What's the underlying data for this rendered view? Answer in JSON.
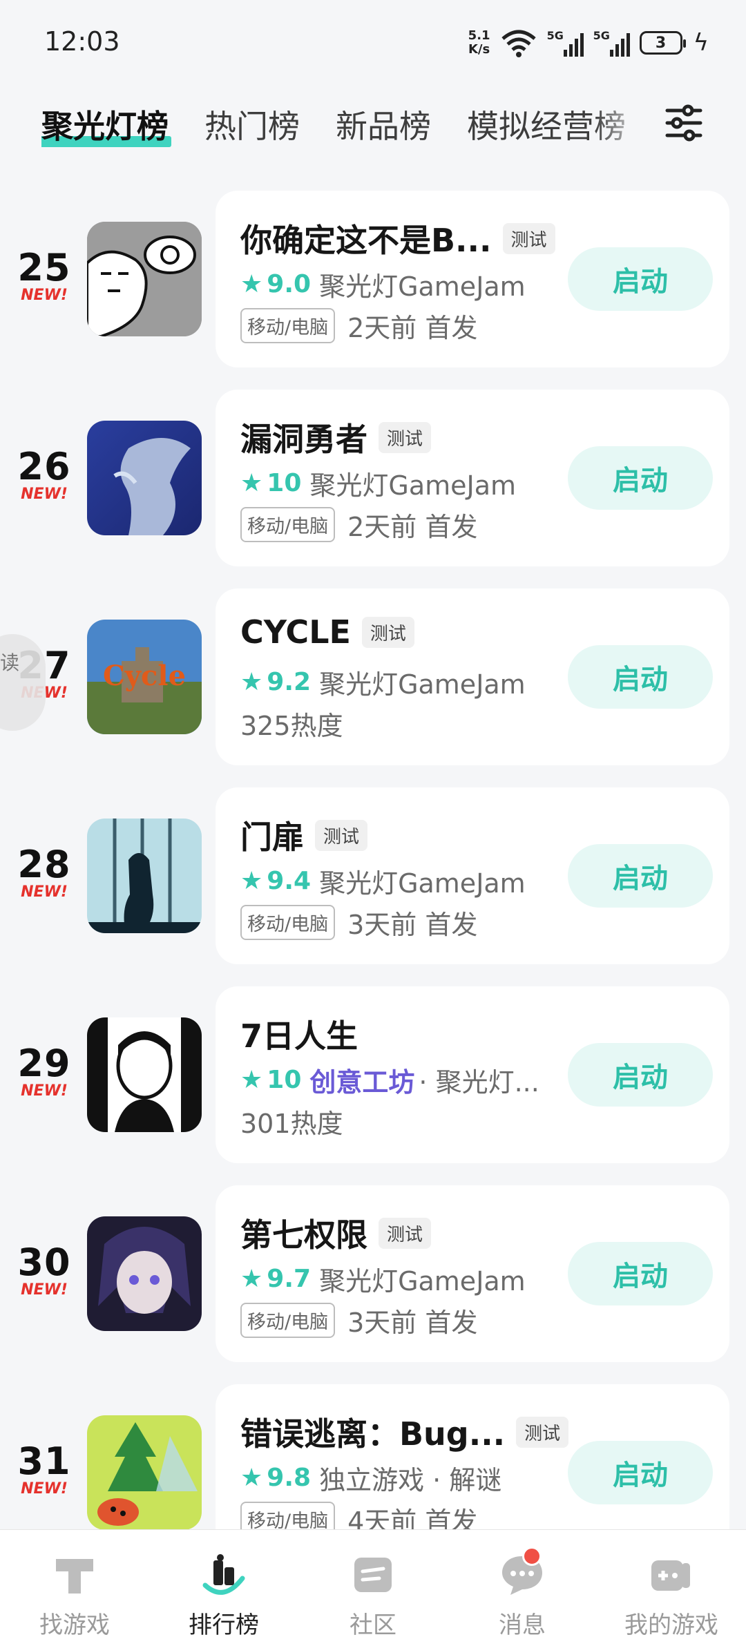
{
  "status": {
    "time": "12:03",
    "net_speed_top": "5.1",
    "net_speed_bottom": "K/s",
    "signal1_label": "5G",
    "signal2_label": "5G",
    "battery": "3"
  },
  "tabs": [
    {
      "label": "聚光灯榜",
      "active": true
    },
    {
      "label": "热门榜"
    },
    {
      "label": "新品榜"
    },
    {
      "label": "模拟经营榜"
    }
  ],
  "float_label": "读",
  "launch_label": "启动",
  "new_label": "NEW!",
  "games": [
    {
      "rank": "25",
      "title": "你确定这不是B...",
      "tag": "测试",
      "score": "9.0",
      "meta": "聚光灯GameJam",
      "platform": "移动/电脑",
      "info": "2天前 首发"
    },
    {
      "rank": "26",
      "title": "漏洞勇者",
      "tag": "测试",
      "score": "10",
      "meta": "聚光灯GameJam",
      "platform": "移动/电脑",
      "info": "2天前 首发"
    },
    {
      "rank": "27",
      "title": "CYCLE",
      "tag": "测试",
      "score": "9.2",
      "meta": "聚光灯GameJam",
      "platform": "",
      "info": "325热度"
    },
    {
      "rank": "28",
      "title": "门扉",
      "tag": "测试",
      "score": "9.4",
      "meta": "聚光灯GameJam",
      "platform": "移动/电脑",
      "info": "3天前 首发"
    },
    {
      "rank": "29",
      "title": "7日人生",
      "tag": "",
      "score": "10",
      "meta_highlight": "创意工坊",
      "meta": "· 聚光灯...",
      "platform": "",
      "info": "301热度"
    },
    {
      "rank": "30",
      "title": "第七权限",
      "tag": "测试",
      "score": "9.7",
      "meta": "聚光灯GameJam",
      "platform": "移动/电脑",
      "info": "3天前 首发"
    },
    {
      "rank": "31",
      "title": "错误逃离：Bug...",
      "tag": "测试",
      "score": "9.8",
      "meta": "独立游戏 · 解谜",
      "platform": "移动/电脑",
      "info": "4天前 首发"
    }
  ],
  "bottom_nav": [
    {
      "label": "找游戏",
      "icon": "find-game-icon"
    },
    {
      "label": "排行榜",
      "icon": "ranking-icon",
      "active": true
    },
    {
      "label": "社区",
      "icon": "community-icon"
    },
    {
      "label": "消息",
      "icon": "message-icon",
      "badge": true
    },
    {
      "label": "我的游戏",
      "icon": "my-games-icon"
    }
  ],
  "colors": {
    "accent": "#3fd3bf",
    "score": "#35c5ae",
    "new_badge": "#e5322d",
    "launch_bg": "#e6f8f5"
  }
}
